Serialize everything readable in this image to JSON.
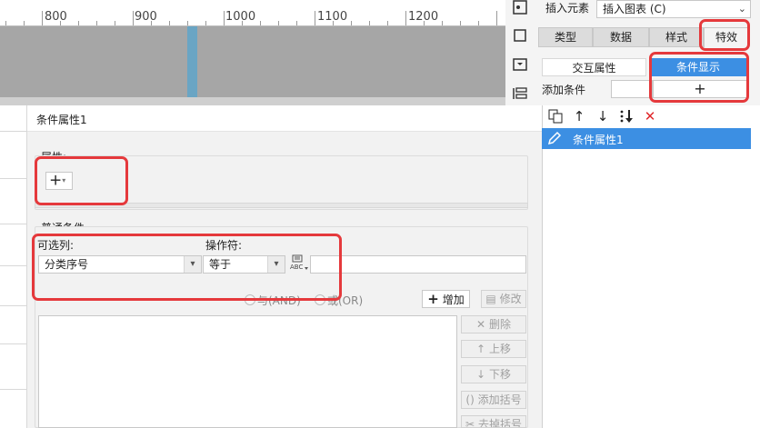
{
  "ruler": {
    "labels": [
      "800",
      "900",
      "1000",
      "1100",
      "1200"
    ]
  },
  "right_panel": {
    "insert_element": "插入元素",
    "insert_chart": "插入图表 (C)",
    "tabs": [
      "类型",
      "数据",
      "样式",
      "特效"
    ],
    "subtabs": [
      "交互属性",
      "条件显示"
    ],
    "add_condition_label": "添加条件",
    "add_symbol": "+",
    "list_items": [
      "条件属性1"
    ]
  },
  "dialog": {
    "title": "条件属性1",
    "attribute_section": "属性:",
    "add_attr_symbol": "+",
    "common_condition": "普通条件",
    "optional_column_label": "可选列:",
    "operator_label": "操作符:",
    "column_value": "分类序号",
    "operator_value": "等于",
    "value_input": "",
    "radio_and": "与(AND)",
    "radio_or": "或(OR)",
    "add_button": "增加",
    "modify_button": "修改",
    "delete_button": "删除",
    "move_up_button": "上移",
    "move_down_button": "下移",
    "add_bracket_button": "添加括号",
    "remove_bracket_button": "去掉括号"
  },
  "colors": {
    "accent": "#3c8fe3",
    "highlight": "#e5393c",
    "marker": "#6aa5c4"
  }
}
